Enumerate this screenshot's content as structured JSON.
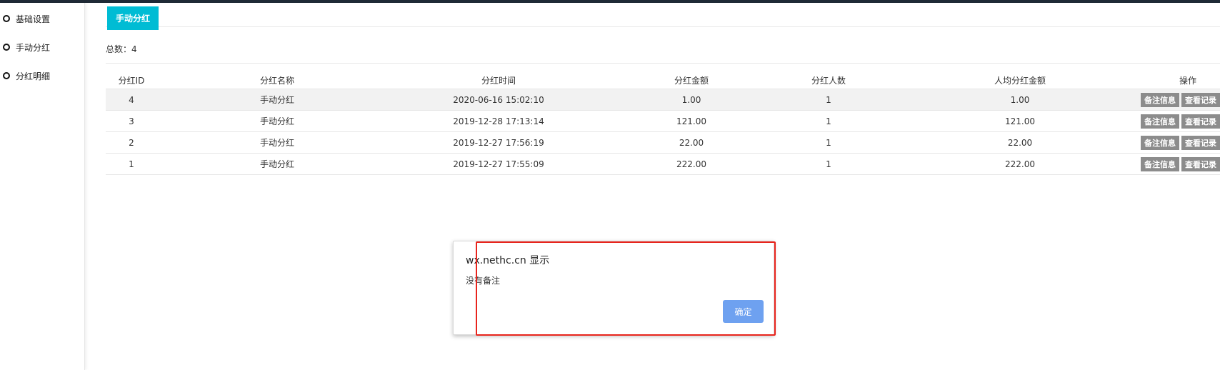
{
  "sidebar": {
    "items": [
      {
        "label": "基础设置"
      },
      {
        "label": "手动分红"
      },
      {
        "label": "分红明细"
      }
    ]
  },
  "tabs": {
    "active": "手动分红"
  },
  "summary": {
    "total_label": "总数：",
    "total_value": "4"
  },
  "table": {
    "columns": [
      "分红ID",
      "分红名称",
      "分红时间",
      "分红金额",
      "分红人数",
      "人均分红金额",
      "操作"
    ],
    "rows": [
      {
        "id": "4",
        "name": "手动分红",
        "time": "2020-06-16 15:02:10",
        "amount": "1.00",
        "count": "1",
        "avg": "1.00"
      },
      {
        "id": "3",
        "name": "手动分红",
        "time": "2019-12-28 17:13:14",
        "amount": "121.00",
        "count": "1",
        "avg": "121.00"
      },
      {
        "id": "2",
        "name": "手动分红",
        "time": "2019-12-27 17:56:19",
        "amount": "22.00",
        "count": "1",
        "avg": "22.00"
      },
      {
        "id": "1",
        "name": "手动分红",
        "time": "2019-12-27 17:55:09",
        "amount": "222.00",
        "count": "1",
        "avg": "222.00"
      }
    ],
    "actions": {
      "remark": "备注信息",
      "records": "查看记录"
    }
  },
  "dialog": {
    "title": "wx.nethc.cn 显示",
    "message": "没有备注",
    "ok_label": "确定"
  },
  "colors": {
    "accent": "#00bcd4",
    "action_button": "#8c8c8c",
    "dialog_ok": "#6ea1f0",
    "highlight_box": "#e8241c"
  }
}
